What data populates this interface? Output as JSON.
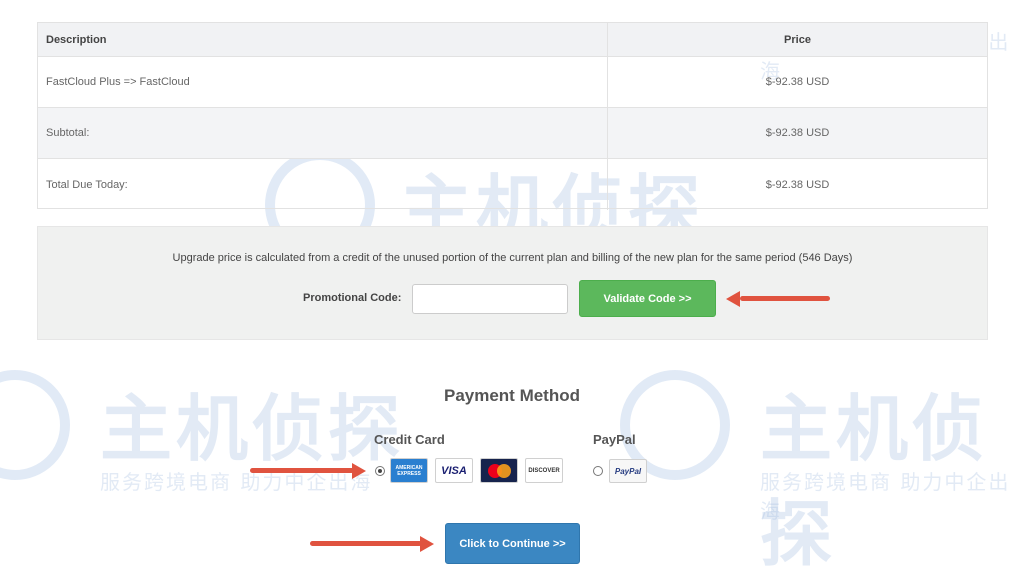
{
  "watermark": {
    "brand": "主机侦探",
    "slogan": "服务跨境电商  助力中企出海"
  },
  "order_table": {
    "headers": {
      "description": "Description",
      "price": "Price"
    },
    "rows": [
      {
        "description": "FastCloud Plus => FastCloud",
        "price": "$-92.38 USD"
      },
      {
        "description": "Subtotal:",
        "price": "$-92.38 USD"
      },
      {
        "description": "Total Due Today:",
        "price": "$-92.38 USD"
      }
    ]
  },
  "promo": {
    "note": "Upgrade price is calculated from a credit of the unused portion of the current plan and billing of the new plan for the same period (546 Days)",
    "label": "Promotional Code:",
    "input_value": "",
    "input_placeholder": "",
    "validate_label": "Validate Code >>"
  },
  "payment": {
    "title": "Payment Method",
    "credit_card_label": "Credit Card",
    "paypal_label": "PayPal",
    "selected": "credit_card",
    "cards": [
      "amex-icon",
      "visa-icon",
      "mastercard-icon",
      "discover-icon"
    ],
    "amex_text": "AMERICAN EXPRESS",
    "visa_text": "VISA",
    "discover_text": "DISCOVER",
    "paypal_text": "PayPal"
  },
  "continue_label": "Click to Continue >>",
  "colors": {
    "validate_green": "#5cb85c",
    "continue_blue": "#3b87c2",
    "arrow_red": "#e0533f"
  }
}
